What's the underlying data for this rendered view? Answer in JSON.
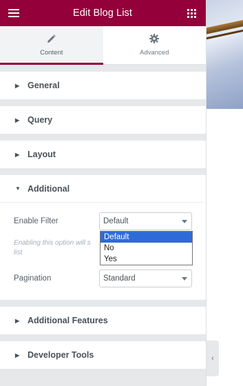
{
  "header": {
    "title": "Edit Blog List",
    "menu_icon": "hamburger-icon",
    "apps_icon": "grid-icon",
    "color": "#93003a"
  },
  "tabs": [
    {
      "label": "Content",
      "icon": "pencil-icon",
      "active": true
    },
    {
      "label": "Advanced",
      "icon": "gear-icon",
      "active": false
    }
  ],
  "sections": {
    "general": "General",
    "query": "Query",
    "layout": "Layout",
    "additional": "Additional",
    "additional_features": "Additional Features",
    "developer_tools": "Developer Tools"
  },
  "additional": {
    "enable_filter_label": "Enable Filter",
    "enable_filter_value": "Default",
    "enable_filter_desc": "Enabling this option will s list",
    "enable_filter_options": [
      "Default",
      "No",
      "Yes"
    ],
    "enable_filter_highlighted": "Default",
    "pagination_label": "Pagination",
    "pagination_value": "Standard"
  },
  "preview": {
    "collapse_icon": "chevron-left-icon"
  }
}
